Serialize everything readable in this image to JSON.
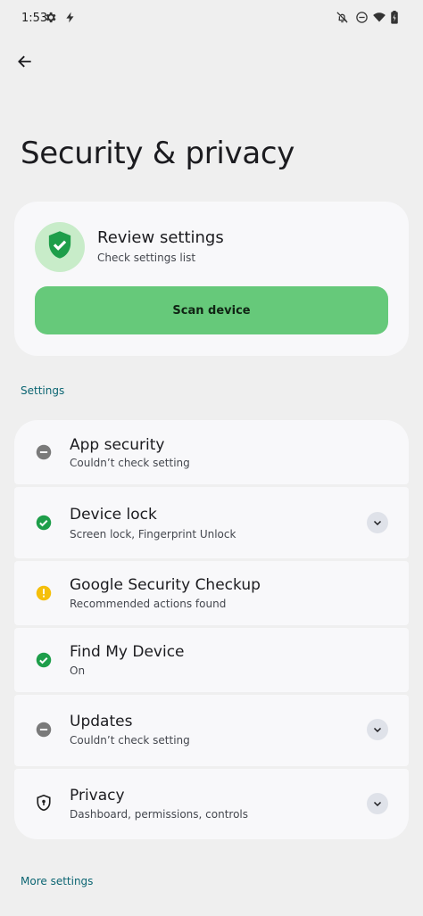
{
  "status_bar": {
    "time": "1:53",
    "left_icons": [
      "settings-gear-icon",
      "bolt-icon"
    ],
    "right_icons": [
      "notifications-off-icon",
      "do-not-disturb-icon",
      "wifi-icon",
      "battery-icon"
    ]
  },
  "header": {
    "back_icon": "arrow-back-icon",
    "title": "Security & privacy"
  },
  "review": {
    "icon": "shield-check-icon",
    "title": "Review settings",
    "subtitle": "Check settings list",
    "button_label": "Scan device"
  },
  "settings_section": {
    "label": "Settings",
    "items": [
      {
        "title": "App security",
        "subtitle": "Couldn’t check setting",
        "status_icon": "minus-circle-icon",
        "status_color": "#7a7a7a",
        "expandable": false
      },
      {
        "title": "Device lock",
        "subtitle": "Screen lock, Fingerprint Unlock",
        "status_icon": "check-circle-icon",
        "status_color": "#1e9e4a",
        "expandable": true
      },
      {
        "title": "Google Security Checkup",
        "subtitle": "Recommended actions found",
        "status_icon": "alert-circle-icon",
        "status_color": "#f5bf0a",
        "expandable": false
      },
      {
        "title": "Find My Device",
        "subtitle": "On",
        "status_icon": "check-circle-icon",
        "status_color": "#1e9e4a",
        "expandable": false
      },
      {
        "title": "Updates",
        "subtitle": "Couldn’t check setting",
        "status_icon": "minus-circle-icon",
        "status_color": "#7a7a7a",
        "expandable": true
      },
      {
        "title": "Privacy",
        "subtitle": "Dashboard, permissions, controls",
        "status_icon": "shield-lock-icon",
        "status_color": "#1f1f1f",
        "expandable": true
      }
    ]
  },
  "more_settings": {
    "label": "More settings"
  },
  "colors": {
    "background": "#efefef",
    "card": "#f8f8fa",
    "accent_green": "#66c97a",
    "section_label": "#0b6572"
  }
}
